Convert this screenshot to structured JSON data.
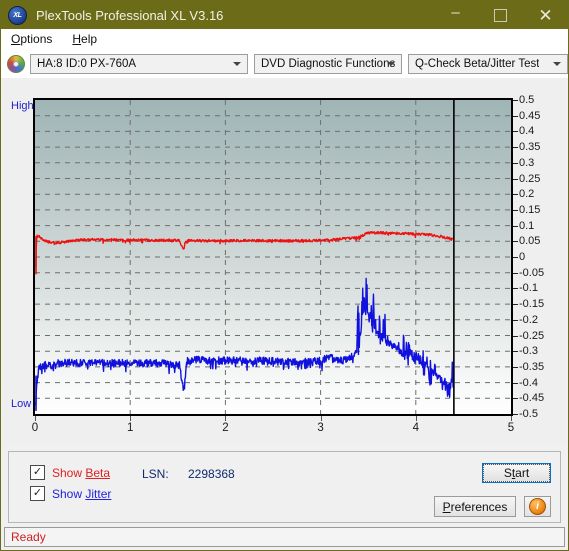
{
  "window": {
    "title": "PlexTools Professional XL V3.16",
    "icon": "app-xl-icon",
    "icon_text": "XL",
    "minimize": "–",
    "maximize": "□",
    "close": "✕",
    "titlebar_color": "#6b6b18"
  },
  "menubar": {
    "items": [
      {
        "label": "Options",
        "accel": "O"
      },
      {
        "label": "Help",
        "accel": "H"
      }
    ]
  },
  "toolbar": {
    "disc_icon": "optical-disc-icon",
    "drive_select": {
      "value": "HA:8 ID:0  PX-760A"
    },
    "function_select": {
      "value": "DVD Diagnostic Functions"
    },
    "test_select": {
      "value": "Q-Check Beta/Jitter Test"
    }
  },
  "chart_data": {
    "type": "line",
    "title": "",
    "xlabel": "",
    "ylabel": "",
    "xlim": [
      0,
      5
    ],
    "ylim": [
      -0.5,
      0.5
    ],
    "x_ticks": [
      "0",
      "1",
      "2",
      "3",
      "4",
      "5"
    ],
    "y_ticks": [
      "0.5",
      "0.45",
      "0.4",
      "0.35",
      "0.3",
      "0.25",
      "0.2",
      "0.15",
      "0.1",
      "0.05",
      "0",
      "-0.05",
      "-0.1",
      "-0.15",
      "-0.2",
      "-0.25",
      "-0.3",
      "-0.35",
      "-0.4",
      "-0.45",
      "-0.5"
    ],
    "axis_top_label": "High",
    "axis_bottom_label": "Low",
    "grid": true,
    "legend_position": "below-chart",
    "end_marker_x": 4.4,
    "series": [
      {
        "name": "Beta",
        "color": "#ee1111",
        "visible": true,
        "x": [
          0.0,
          0.02,
          0.04,
          0.06,
          0.09,
          0.12,
          0.16,
          0.21,
          0.27,
          0.35,
          0.45,
          0.55,
          0.65,
          0.75,
          0.85,
          0.95,
          1.1,
          1.25,
          1.4,
          1.52,
          1.56,
          1.58,
          1.62,
          1.75,
          1.9,
          2.05,
          2.2,
          2.4,
          2.6,
          2.8,
          3.0,
          3.1,
          3.18,
          3.22,
          3.3,
          3.4,
          3.48,
          3.55,
          3.65,
          3.75,
          3.85,
          3.95,
          4.05,
          4.15,
          4.25,
          4.32,
          4.36,
          4.4
        ],
        "y": [
          -0.03,
          0.065,
          0.068,
          0.062,
          0.055,
          0.05,
          0.047,
          0.046,
          0.046,
          0.05,
          0.054,
          0.055,
          0.055,
          0.055,
          0.055,
          0.054,
          0.054,
          0.053,
          0.053,
          0.053,
          0.02,
          0.05,
          0.052,
          0.052,
          0.052,
          0.052,
          0.052,
          0.052,
          0.052,
          0.052,
          0.053,
          0.054,
          0.056,
          0.058,
          0.06,
          0.062,
          0.075,
          0.078,
          0.077,
          0.076,
          0.075,
          0.074,
          0.072,
          0.07,
          0.066,
          0.062,
          0.058,
          0.055
        ]
      },
      {
        "name": "Jitter",
        "color": "#1111dd",
        "visible": true,
        "x": [
          0.0,
          0.02,
          0.04,
          0.07,
          0.12,
          0.2,
          0.3,
          0.45,
          0.6,
          0.8,
          1.0,
          1.2,
          1.4,
          1.52,
          1.56,
          1.6,
          1.7,
          1.85,
          2.0,
          2.2,
          2.4,
          2.6,
          2.8,
          3.0,
          3.1,
          3.15,
          3.22,
          3.3,
          3.4,
          3.45,
          3.5,
          3.55,
          3.62,
          3.7,
          3.8,
          3.9,
          4.0,
          4.1,
          4.2,
          4.3,
          4.36,
          4.4
        ],
        "y": [
          -0.47,
          -0.4,
          -0.355,
          -0.345,
          -0.345,
          -0.34,
          -0.338,
          -0.337,
          -0.337,
          -0.338,
          -0.338,
          -0.338,
          -0.34,
          -0.345,
          -0.425,
          -0.33,
          -0.328,
          -0.33,
          -0.33,
          -0.33,
          -0.331,
          -0.333,
          -0.335,
          -0.33,
          -0.318,
          -0.33,
          -0.33,
          -0.325,
          -0.3,
          -0.16,
          -0.19,
          -0.23,
          -0.25,
          -0.27,
          -0.295,
          -0.31,
          -0.325,
          -0.345,
          -0.37,
          -0.395,
          -0.415,
          -0.33
        ]
      }
    ]
  },
  "controls": {
    "show_beta": {
      "label_prefix": "Show ",
      "label_key": "Beta",
      "checked": true,
      "color": "#e02020"
    },
    "show_jitter": {
      "label_prefix": "Show ",
      "label_key": "Jitter",
      "checked": true,
      "color": "#2222dd"
    },
    "lsn_label": "LSN:",
    "lsn_value": "2298368",
    "start_button": {
      "prefix": "S",
      "accel": "t",
      "suffix": "art",
      "full": "Start",
      "focused": true
    },
    "preferences_button": {
      "accel": "P",
      "rest": "references",
      "full": "Preferences"
    },
    "info_button": {
      "icon": "info-icon",
      "glyph": "i"
    }
  },
  "statusbar": {
    "text": "Ready",
    "color": "#d02020"
  }
}
